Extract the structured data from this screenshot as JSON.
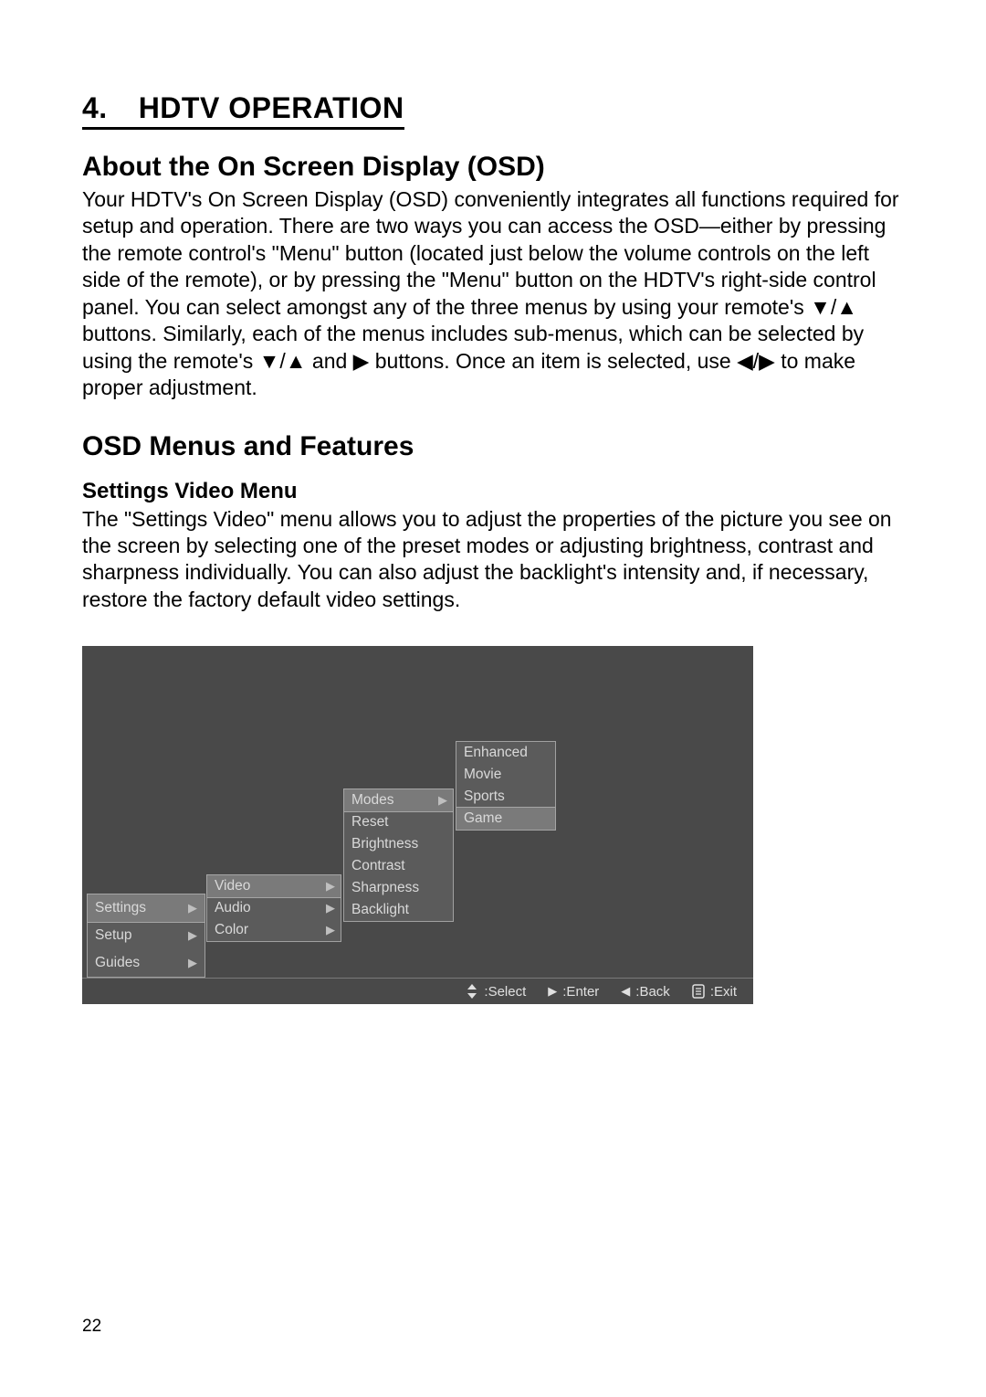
{
  "section": {
    "number": "4.",
    "title": "HDTV OPERATION"
  },
  "about": {
    "heading": "About the On Screen Display (OSD)",
    "body": "Your HDTV's On Screen Display (OSD) conveniently integrates all functions required for setup and operation. There are two ways you can access the OSD—either by pressing the remote control's \"Menu\" button (located just below the volume controls on the left side of the remote), or by pressing the \"Menu\" button on the HDTV's right-side control panel. You can select amongst any of the three menus by using your remote's ▼/▲  buttons. Similarly, each of the menus includes sub-menus, which can be selected by using the remote's ▼/▲ and ▶ buttons.  Once an item is selected, use ◀/▶ to make proper adjustment."
  },
  "menus_heading": "OSD Menus and Features",
  "settings_video": {
    "heading": "Settings Video Menu",
    "body": "The \"Settings Video\" menu allows you to adjust the properties of the picture you see on the screen by selecting one of the preset modes or adjusting brightness, contrast and sharpness individually.  You can also adjust the backlight's intensity and, if necessary, restore the factory default video settings."
  },
  "osd": {
    "main": [
      "Settings",
      "Setup",
      "Guides"
    ],
    "settings_sub": [
      "Video",
      "Audio",
      "Color"
    ],
    "video_sub": [
      "Modes",
      "Reset",
      "Brightness",
      "Contrast",
      "Sharpness",
      "Backlight"
    ],
    "modes_sub": [
      "Enhanced",
      "Movie",
      "Sports",
      "Game"
    ],
    "legend": {
      "select": ":Select",
      "enter": ":Enter",
      "back": ":Back",
      "exit": ":Exit"
    }
  },
  "page_number": "22"
}
